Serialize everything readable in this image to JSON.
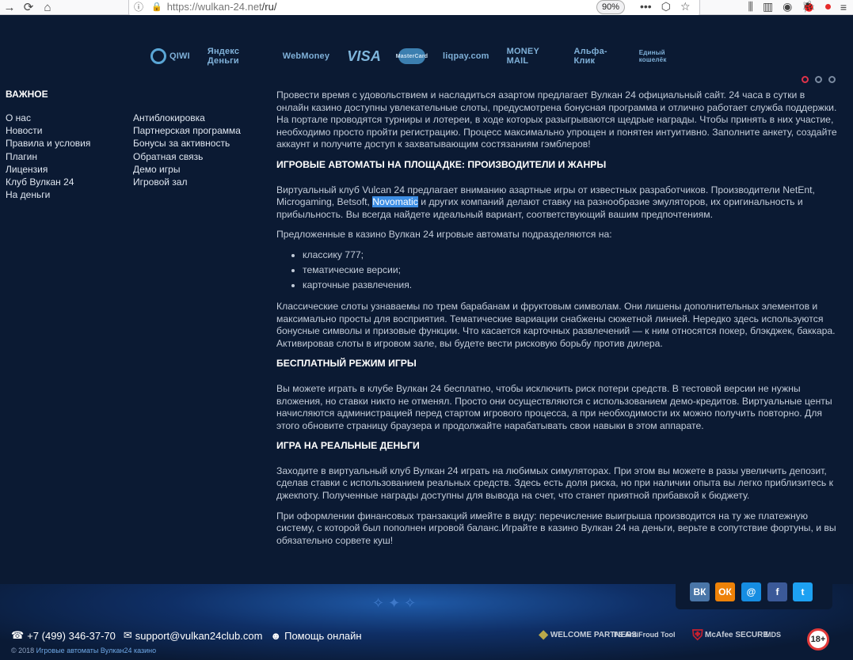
{
  "browser": {
    "back": "←",
    "forward": "→",
    "reload": "⟳",
    "home": "⌂",
    "url_domain": "https://wulkan-24.net",
    "url_path": "/ru/",
    "zoom": "90%",
    "more": "•••",
    "pocket": "⬡",
    "star": "☆"
  },
  "payments": [
    "QIWI",
    "Яндекс Деньги",
    "WebMoney",
    "VISA",
    "MasterCard",
    "liqpay.com",
    "MONEY MAIL",
    "Альфа-Клик",
    "Единый кошелёк"
  ],
  "sidebar": {
    "title": "ВАЖНОЕ",
    "col1": [
      "О нас",
      "Новости",
      "Правила и условия",
      "Плагин",
      "Лицензия",
      "Клуб Вулкан 24",
      "На деньги"
    ],
    "col2": [
      "Антиблокировка",
      "Партнерская программа",
      "Бонусы за активность",
      "Обратная связь",
      "Демо игры",
      "Игровой зал"
    ]
  },
  "main": {
    "intro": "Провести время с удовольствием и насладиться азартом предлагает Вулкан 24 официальный сайт. 24 часа в сутки в онлайн казино доступны увлекательные слоты, предусмотрена бонусная программа и отлично работает служба поддержки. На портале проводятся турниры и лотереи, в ходе которых разыгрываются щедрые награды. Чтобы принять в них участие, необходимо просто пройти регистрацию. Процесс максимально упрощен и понятен интуитивно. Заполните анкету, создайте аккаунт и получите доступ к захватывающим состязаниям гэмблеров!",
    "h1": "ИГРОВЫЕ АВТОМАТЫ НА ПЛОЩАДКЕ: ПРОИЗВОДИТЕЛИ И ЖАНРЫ",
    "p1_a": "Виртуальный клуб Vulcan 24 предлагает вниманию азартные игры от известных разработчиков. Производители NetEnt, Microgaming, Betsoft, ",
    "p1_highlight": "Novomatic",
    "p1_b": " и других компаний делают ставку на разнообразие эмуляторов, их оригинальность и прибыльность. Вы всегда найдете идеальный вариант, соответствующий вашим предпочтениям.",
    "p2": "Предложенные в казино Вулкан 24 игровые автоматы подразделяются на:",
    "list": [
      "классику 777;",
      "тематические версии;",
      "карточные развлечения."
    ],
    "p3": "Классические слоты узнаваемы по трем барабанам и фруктовым символам. Они лишены дополнительных элементов и максимально просты для восприятия. Тематические вариации снабжены сюжетной линией. Нередко здесь используются бонусные символы и призовые функции. Что касается карточных развлечений — к ним относятся покер, блэкджек, баккара. Активировав слоты в игровом зале, вы будете вести рисковую борьбу против дилера.",
    "h2": "БЕСПЛАТНЫЙ РЕЖИМ ИГРЫ",
    "p4": "Вы можете играть в клубе Вулкан 24 бесплатно, чтобы исключить риск потери средств. В тестовой версии не нужны вложения, но ставки никто не отменял. Просто они осуществляются с использованием демо-кредитов. Виртуальные центы начисляются администрацией перед стартом игрового процесса, а при необходимости их можно получить повторно. Для этого обновите страницу браузера и продолжайте нарабатывать свои навыки в этом аппарате.",
    "h3": "ИГРА НА РЕАЛЬНЫЕ ДЕНЬГИ",
    "p5": "Заходите в виртуальный клуб Вулкан 24 играть на любимых симуляторах. При этом вы можете в разы увеличить депозит, сделав ставки с использованием реальных средств. Здесь есть доля риска, но при наличии опыта вы легко приблизитесь к джекпоту. Полученные награды доступны для вывода на счет, что станет приятной прибавкой к бюджету.",
    "p6": "При оформлении финансовых транзакций имейте в виду: перечисление выигрыша производится на ту же платежную систему, с которой был пополнен игровой баланс.Играйте в казино Вулкан 24 на деньги, верьте в сопутствие фортуны, и вы обязательно сорвете куш!"
  },
  "footer": {
    "phone": "+7 (499) 346-37-70",
    "email": "support@vulkan24club.com",
    "help": "Помощь онлайн",
    "copyright": "© 2018",
    "copyright_link": "Игровые автоматы Вулкан24 казино",
    "badges": [
      "WELCOME PARTNERS",
      "FS AntiFroud Tool",
      "McAfee SECURE",
      "MDS",
      "18+"
    ],
    "social": [
      "ВК",
      "ОК",
      "@",
      "f",
      "t"
    ]
  },
  "colors": {
    "background": "#0b1a33",
    "highlight": "#3d8ee4",
    "heading": "#ffffff",
    "text": "#c3ccd9",
    "vk": "#4a76a8",
    "ok": "#ee8208",
    "mail": "#168de2",
    "facebook": "#3b5998",
    "twitter": "#1da1f2"
  }
}
